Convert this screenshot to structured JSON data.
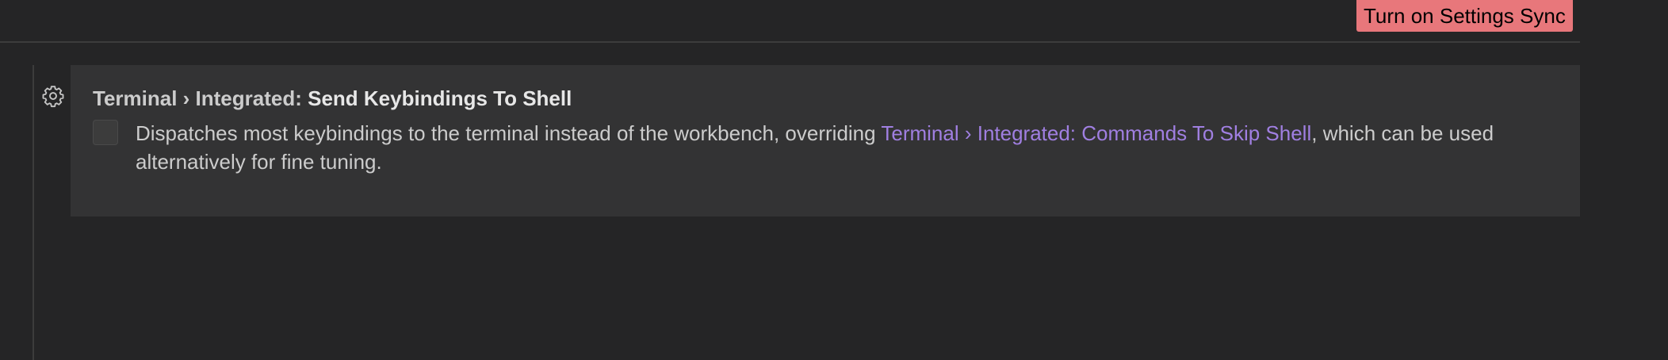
{
  "header": {
    "sync_button_label": "Turn on Settings Sync"
  },
  "setting": {
    "category": "Terminal › Integrated: ",
    "label": "Send Keybindings To Shell",
    "checked": false,
    "description_before": "Dispatches most keybindings to the terminal instead of the workbench, overriding ",
    "description_link": "Terminal › Integrated: Commands To Skip Shell",
    "description_after": ", which can be used alternatively for fine tuning.",
    "gear_icon": "gear-icon"
  },
  "colors": {
    "background": "#252526",
    "row_background": "#333334",
    "sync_button": "#e8777b",
    "link": "#a07fe1",
    "text": "#cccccc"
  }
}
